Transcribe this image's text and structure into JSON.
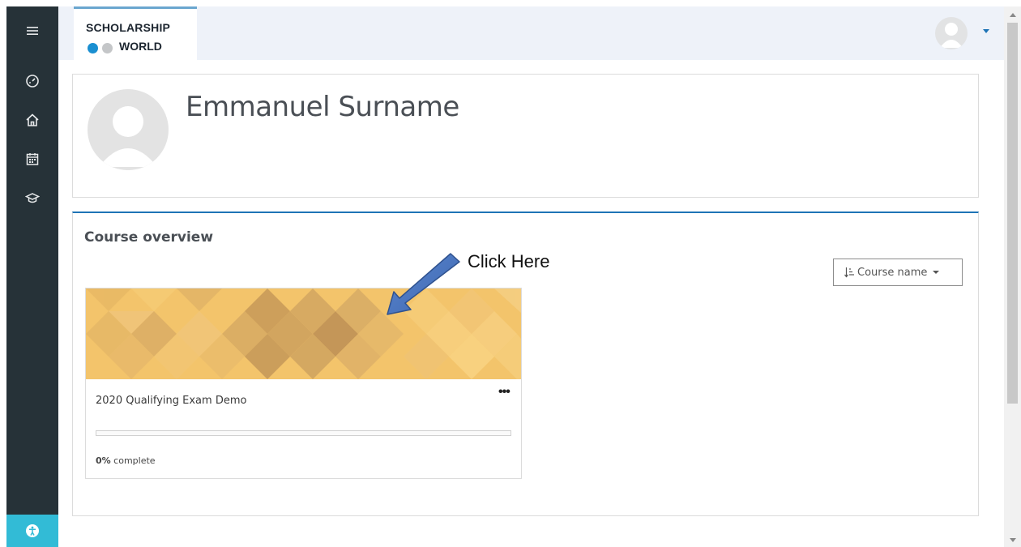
{
  "header": {
    "logo": {
      "line1": "SCHOLARSHIP",
      "line2": "WORLD"
    },
    "user_menu_icon": "user-avatar-icon"
  },
  "sidebar": {
    "items": [
      {
        "icon": "hamburger-menu-icon"
      },
      {
        "icon": "dashboard-icon"
      },
      {
        "icon": "home-icon"
      },
      {
        "icon": "calendar-icon"
      },
      {
        "icon": "graduation-cap-icon"
      }
    ],
    "accessibility_icon": "accessibility-icon",
    "accent_color": "#32bbd6"
  },
  "profile": {
    "name": "Emmanuel Surname"
  },
  "course_overview": {
    "title": "Course overview",
    "sort_label": "Course name",
    "courses": [
      {
        "name": "2020 Qualifying Exam Demo",
        "progress_percent": 0,
        "progress_value": "0%",
        "progress_suffix": " complete"
      }
    ]
  },
  "annotation": {
    "text": "Click Here",
    "arrow_color": "#4472c4"
  },
  "colors": {
    "primary": "#1e74b6",
    "sidebar_bg": "#263238",
    "header_bg": "#eef2f9"
  }
}
